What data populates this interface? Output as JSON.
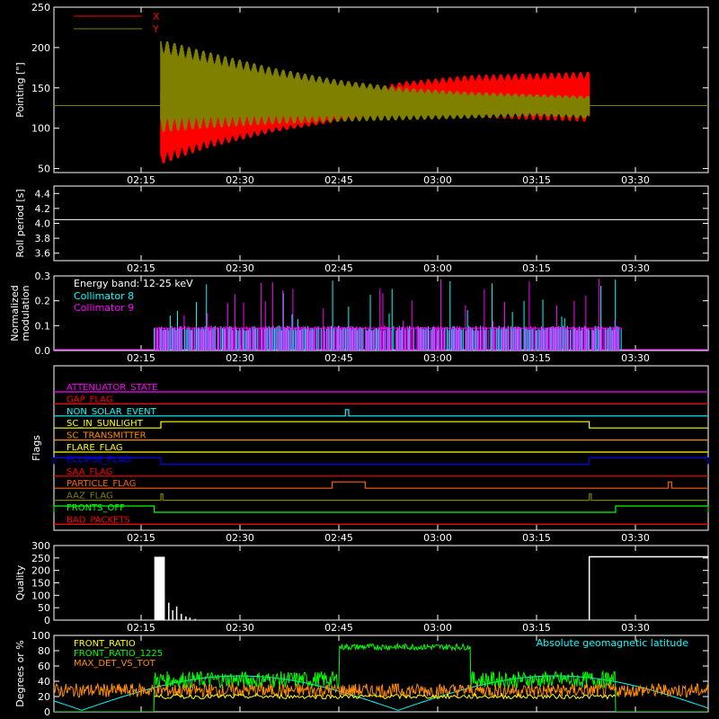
{
  "time_ticks": [
    "02:15",
    "02:30",
    "02:45",
    "03:00",
    "03:15",
    "03:30"
  ],
  "chart_data": [
    {
      "type": "line",
      "ylabel": "Pointing [\"]",
      "ylim": [
        45,
        250
      ],
      "yticks": [
        50,
        100,
        150,
        200,
        250
      ],
      "series": [
        {
          "name": "X",
          "color": "#ff0000",
          "envelope_x": [
            "02:18",
            "02:25",
            "02:35",
            "02:45",
            "02:55",
            "03:05",
            "03:15",
            "03:23"
          ],
          "envelope_upper": [
            148,
            142,
            136,
            142,
            158,
            166,
            168,
            170
          ],
          "envelope_lower": [
            55,
            75,
            95,
            108,
            112,
            113,
            110,
            108
          ],
          "baseline": 128
        },
        {
          "name": "Y",
          "color": "#808000",
          "envelope_x": [
            "02:18",
            "02:25",
            "02:35",
            "02:45",
            "02:55",
            "03:05",
            "03:15",
            "03:23"
          ],
          "envelope_upper": [
            210,
            195,
            175,
            160,
            150,
            145,
            142,
            140
          ],
          "envelope_lower": [
            95,
            100,
            105,
            108,
            110,
            112,
            115,
            112
          ],
          "baseline": 128
        }
      ],
      "legend": "top-left"
    },
    {
      "type": "line",
      "ylabel": "Roll period [s]",
      "ylim": [
        3.5,
        4.5
      ],
      "yticks": [
        3.6,
        3.8,
        4.0,
        4.2,
        4.4
      ],
      "series": [
        {
          "values_constant": 4.05,
          "color": "#ffffff"
        }
      ]
    },
    {
      "type": "bar",
      "ylabel": "Normalized\nmodulation",
      "ylim": [
        0,
        0.3
      ],
      "yticks": [
        0.0,
        0.1,
        0.2,
        0.3
      ],
      "annotation": "Energy band: 12-25 keV",
      "series": [
        {
          "name": "Collimator 8",
          "color": "#00ffff",
          "typical": 0.09,
          "x_range": [
            "02:17",
            "03:28"
          ]
        },
        {
          "name": "Collimator 9",
          "color": "#ff00ff",
          "typical": 0.09,
          "x_range": [
            "02:17",
            "03:28"
          ]
        }
      ]
    },
    {
      "type": "line",
      "ylabel": "Flags",
      "flags": [
        {
          "name": "ATTENUATOR_STATE",
          "color": "#ff00ff",
          "on": []
        },
        {
          "name": "GAP_FLAG",
          "color": "#ff0000",
          "on": []
        },
        {
          "name": "NON_SOLAR_EVENT",
          "color": "#00ffff",
          "on": [
            [
              "02:46",
              "02:46.5"
            ]
          ]
        },
        {
          "name": "SC_IN_SUNLIGHT",
          "color": "#ffff00",
          "on": [
            [
              "02:18",
              "03:23"
            ]
          ]
        },
        {
          "name": "SC_TRANSMITTER",
          "color": "#ff8c00",
          "on": []
        },
        {
          "name": "FLARE_FLAG",
          "color": "#ffff00",
          "on": []
        },
        {
          "name": "ECLIPSE_FLAG",
          "color": "#0000ff",
          "on": [
            [
              "00:00",
              "02:18"
            ],
            [
              "03:23",
              "04:00"
            ]
          ]
        },
        {
          "name": "SAA_FLAG",
          "color": "#ff0000",
          "on": []
        },
        {
          "name": "PARTICLE_FLAG",
          "color": "#ff6000",
          "on": [
            [
              "02:44",
              "02:49"
            ],
            [
              "03:35",
              "03:35.5"
            ]
          ]
        },
        {
          "name": "AAZ_FLAG",
          "color": "#808000",
          "on": [
            [
              "02:18",
              "02:18.3"
            ],
            [
              "03:23",
              "03:23.3"
            ]
          ]
        },
        {
          "name": "FRONTS_OFF",
          "color": "#00ff00",
          "on": [
            [
              "00:00",
              "02:17"
            ],
            [
              "03:27",
              "04:00"
            ]
          ]
        },
        {
          "name": "BAD_PACKETS",
          "color": "#ff0000",
          "on": []
        }
      ]
    },
    {
      "type": "bar",
      "ylabel": "Quality",
      "ylim": [
        0,
        300
      ],
      "yticks": [
        0,
        50,
        100,
        150,
        200,
        250,
        300
      ],
      "series": [
        {
          "color": "#ffffff",
          "points": [
            [
              "02:17",
              255
            ],
            [
              "02:18",
              255
            ],
            [
              "02:19",
              60
            ],
            [
              "02:20",
              30
            ],
            [
              "02:21",
              15
            ],
            [
              "03:23",
              255
            ],
            [
              "03:40",
              255
            ]
          ]
        }
      ]
    },
    {
      "type": "line",
      "ylabel": "Degrees or %",
      "ylim": [
        0,
        100
      ],
      "yticks": [
        0,
        20,
        40,
        60,
        80,
        100
      ],
      "series": [
        {
          "name": "FRONT_RATIO",
          "color": "#ffff00",
          "typical": 20
        },
        {
          "name": "FRONT_RATIO_1225",
          "color": "#00ff00",
          "typical": 42,
          "high_segment": [
            "02:45",
            "03:05"
          ],
          "high_value": 85
        },
        {
          "name": "MAX_DET_VS_TOT",
          "color": "#ff8c00",
          "typical": 28
        },
        {
          "name": "Absolute geomagnetic latitude",
          "color": "#00ffff",
          "shape": "abs-sine"
        }
      ]
    }
  ]
}
